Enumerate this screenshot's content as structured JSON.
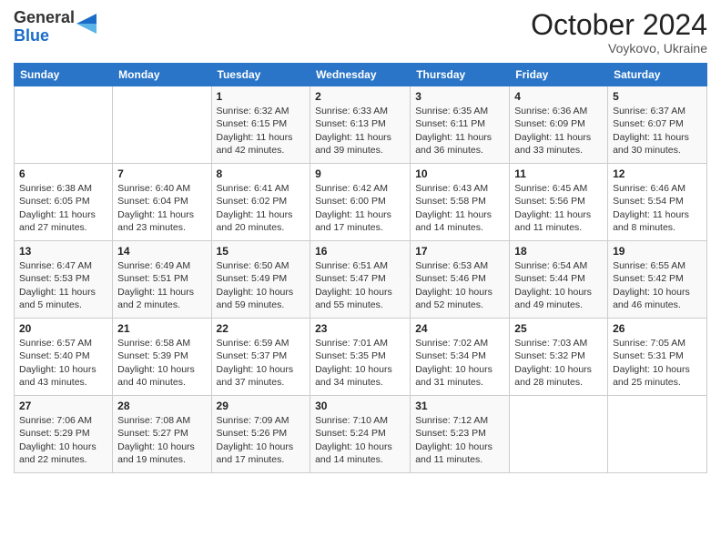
{
  "logo": {
    "general": "General",
    "blue": "Blue"
  },
  "header": {
    "month": "October 2024",
    "location": "Voykovo, Ukraine"
  },
  "weekdays": [
    "Sunday",
    "Monday",
    "Tuesday",
    "Wednesday",
    "Thursday",
    "Friday",
    "Saturday"
  ],
  "weeks": [
    [
      {
        "day": "",
        "info": ""
      },
      {
        "day": "",
        "info": ""
      },
      {
        "day": "1",
        "info": "Sunrise: 6:32 AM\nSunset: 6:15 PM\nDaylight: 11 hours and 42 minutes."
      },
      {
        "day": "2",
        "info": "Sunrise: 6:33 AM\nSunset: 6:13 PM\nDaylight: 11 hours and 39 minutes."
      },
      {
        "day": "3",
        "info": "Sunrise: 6:35 AM\nSunset: 6:11 PM\nDaylight: 11 hours and 36 minutes."
      },
      {
        "day": "4",
        "info": "Sunrise: 6:36 AM\nSunset: 6:09 PM\nDaylight: 11 hours and 33 minutes."
      },
      {
        "day": "5",
        "info": "Sunrise: 6:37 AM\nSunset: 6:07 PM\nDaylight: 11 hours and 30 minutes."
      }
    ],
    [
      {
        "day": "6",
        "info": "Sunrise: 6:38 AM\nSunset: 6:05 PM\nDaylight: 11 hours and 27 minutes."
      },
      {
        "day": "7",
        "info": "Sunrise: 6:40 AM\nSunset: 6:04 PM\nDaylight: 11 hours and 23 minutes."
      },
      {
        "day": "8",
        "info": "Sunrise: 6:41 AM\nSunset: 6:02 PM\nDaylight: 11 hours and 20 minutes."
      },
      {
        "day": "9",
        "info": "Sunrise: 6:42 AM\nSunset: 6:00 PM\nDaylight: 11 hours and 17 minutes."
      },
      {
        "day": "10",
        "info": "Sunrise: 6:43 AM\nSunset: 5:58 PM\nDaylight: 11 hours and 14 minutes."
      },
      {
        "day": "11",
        "info": "Sunrise: 6:45 AM\nSunset: 5:56 PM\nDaylight: 11 hours and 11 minutes."
      },
      {
        "day": "12",
        "info": "Sunrise: 6:46 AM\nSunset: 5:54 PM\nDaylight: 11 hours and 8 minutes."
      }
    ],
    [
      {
        "day": "13",
        "info": "Sunrise: 6:47 AM\nSunset: 5:53 PM\nDaylight: 11 hours and 5 minutes."
      },
      {
        "day": "14",
        "info": "Sunrise: 6:49 AM\nSunset: 5:51 PM\nDaylight: 11 hours and 2 minutes."
      },
      {
        "day": "15",
        "info": "Sunrise: 6:50 AM\nSunset: 5:49 PM\nDaylight: 10 hours and 59 minutes."
      },
      {
        "day": "16",
        "info": "Sunrise: 6:51 AM\nSunset: 5:47 PM\nDaylight: 10 hours and 55 minutes."
      },
      {
        "day": "17",
        "info": "Sunrise: 6:53 AM\nSunset: 5:46 PM\nDaylight: 10 hours and 52 minutes."
      },
      {
        "day": "18",
        "info": "Sunrise: 6:54 AM\nSunset: 5:44 PM\nDaylight: 10 hours and 49 minutes."
      },
      {
        "day": "19",
        "info": "Sunrise: 6:55 AM\nSunset: 5:42 PM\nDaylight: 10 hours and 46 minutes."
      }
    ],
    [
      {
        "day": "20",
        "info": "Sunrise: 6:57 AM\nSunset: 5:40 PM\nDaylight: 10 hours and 43 minutes."
      },
      {
        "day": "21",
        "info": "Sunrise: 6:58 AM\nSunset: 5:39 PM\nDaylight: 10 hours and 40 minutes."
      },
      {
        "day": "22",
        "info": "Sunrise: 6:59 AM\nSunset: 5:37 PM\nDaylight: 10 hours and 37 minutes."
      },
      {
        "day": "23",
        "info": "Sunrise: 7:01 AM\nSunset: 5:35 PM\nDaylight: 10 hours and 34 minutes."
      },
      {
        "day": "24",
        "info": "Sunrise: 7:02 AM\nSunset: 5:34 PM\nDaylight: 10 hours and 31 minutes."
      },
      {
        "day": "25",
        "info": "Sunrise: 7:03 AM\nSunset: 5:32 PM\nDaylight: 10 hours and 28 minutes."
      },
      {
        "day": "26",
        "info": "Sunrise: 7:05 AM\nSunset: 5:31 PM\nDaylight: 10 hours and 25 minutes."
      }
    ],
    [
      {
        "day": "27",
        "info": "Sunrise: 7:06 AM\nSunset: 5:29 PM\nDaylight: 10 hours and 22 minutes."
      },
      {
        "day": "28",
        "info": "Sunrise: 7:08 AM\nSunset: 5:27 PM\nDaylight: 10 hours and 19 minutes."
      },
      {
        "day": "29",
        "info": "Sunrise: 7:09 AM\nSunset: 5:26 PM\nDaylight: 10 hours and 17 minutes."
      },
      {
        "day": "30",
        "info": "Sunrise: 7:10 AM\nSunset: 5:24 PM\nDaylight: 10 hours and 14 minutes."
      },
      {
        "day": "31",
        "info": "Sunrise: 7:12 AM\nSunset: 5:23 PM\nDaylight: 10 hours and 11 minutes."
      },
      {
        "day": "",
        "info": ""
      },
      {
        "day": "",
        "info": ""
      }
    ]
  ]
}
